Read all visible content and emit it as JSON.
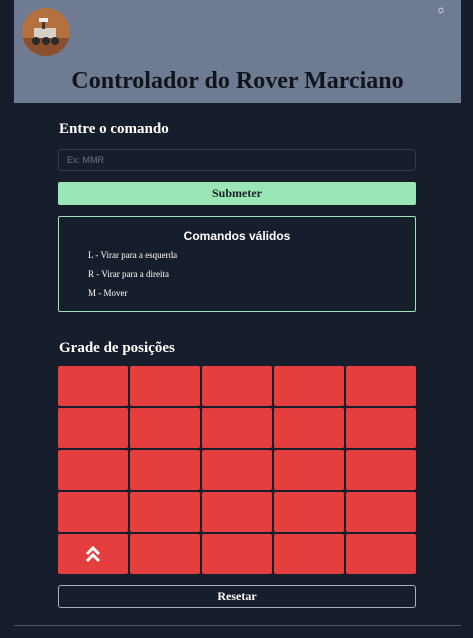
{
  "header": {
    "avatar_icon": "mars-rover-avatar",
    "theme_toggle_icon": "sun-icon",
    "title": "Controlador do Rover Marciano"
  },
  "command": {
    "heading": "Entre o comando",
    "input_placeholder": "Ex: MMR",
    "input_value": "",
    "submit_label": "Submeter"
  },
  "valid_commands": {
    "title": "Comandos válidos",
    "items": [
      "L - Virar para a esquerda",
      "R - Virar para a direita",
      "M - Mover"
    ]
  },
  "grid": {
    "heading": "Grade de posições",
    "rows": 5,
    "cols": 5,
    "rover_position": {
      "row": 5,
      "col": 1
    },
    "rover_icon": "double-chevron-up-icon",
    "cell_color": "#e53e3e"
  },
  "reset_label": "Resetar",
  "colors": {
    "background": "#171e2b",
    "header": "#6f7b92",
    "accent_green": "#9ae6b4",
    "cell_red": "#e53e3e"
  }
}
